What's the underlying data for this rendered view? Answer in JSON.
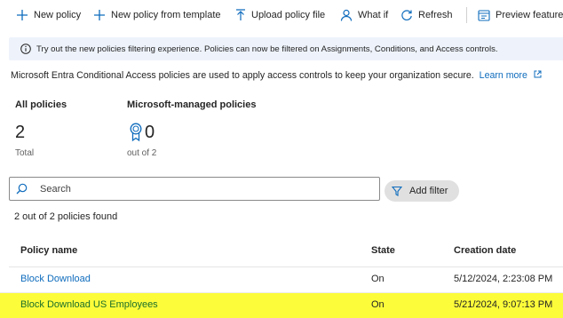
{
  "toolbar": {
    "new_policy": "New policy",
    "new_policy_from_template": "New policy from template",
    "upload_policy_file": "Upload policy file",
    "what_if": "What if",
    "refresh": "Refresh",
    "preview_features": "Preview feature"
  },
  "banner": {
    "text": "Try out the new policies filtering experience. Policies can now be filtered on Assignments, Conditions, and Access controls."
  },
  "description": {
    "text": "Microsoft Entra Conditional Access policies are used to apply access controls to keep your organization secure.",
    "learn_more": "Learn more"
  },
  "stats": {
    "all_policies": {
      "label": "All policies",
      "value": "2",
      "sub": "Total"
    },
    "managed_policies": {
      "label": "Microsoft-managed policies",
      "value": "0",
      "sub": "out of 2"
    }
  },
  "search": {
    "placeholder": "Search",
    "value": ""
  },
  "add_filter": "Add filter",
  "found_text": "2 out of 2 policies found",
  "table": {
    "headers": {
      "name": "Policy name",
      "state": "State",
      "created": "Creation date"
    },
    "rows": [
      {
        "name": "Block Download",
        "state": "On",
        "created": "5/12/2024, 2:23:08 PM"
      },
      {
        "name": "Block Download US Employees",
        "state": "On",
        "created": "5/21/2024, 9:07:13 PM"
      }
    ]
  },
  "colors": {
    "accent": "#0f6cbd",
    "highlight": "#fcfc3a",
    "banner_bg": "#eef3fb"
  }
}
